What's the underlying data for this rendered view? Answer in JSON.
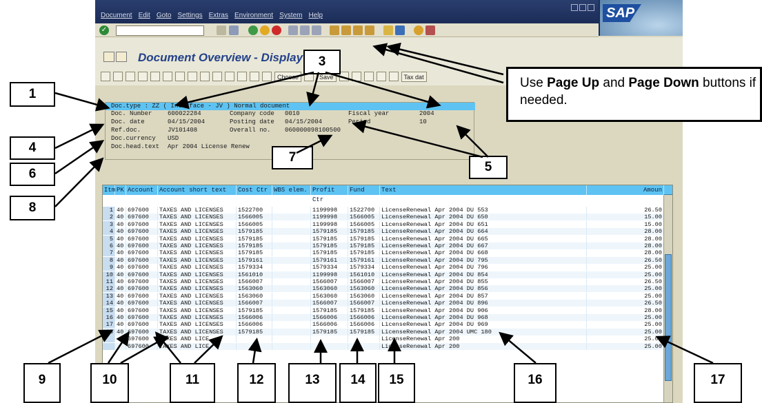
{
  "menu": [
    "Document",
    "Edit",
    "Goto",
    "Settings",
    "Extras",
    "Environment",
    "System",
    "Help"
  ],
  "app_logo": "SAP",
  "screen_title": "Document Overview - Display",
  "toolbar": {
    "choose_label": "Choose",
    "save_label": "Save",
    "tax_label": "Tax dat"
  },
  "header": {
    "line1": "Doc.type : ZZ ( Interface - JV ) Normal document",
    "doc_number_label": "Doc. Number",
    "doc_number": "600022284",
    "company_code_label": "Company code",
    "company_code": "0010",
    "fiscal_year_label": "Fiscal year",
    "fiscal_year": "2004",
    "doc_date_label": "Doc. date",
    "doc_date": "04/15/2004",
    "posting_date_label": "Posting date",
    "posting_date": "04/15/2004",
    "period_label": "Period",
    "period": "10",
    "ref_doc_label": "Ref.doc.",
    "ref_doc": "JV101408",
    "overall_no_label": "Overall no.",
    "overall_no": "060000098100500",
    "currency_label": "Doc.currency",
    "currency": "USD",
    "head_text_label": "Doc.head.text",
    "head_text": "Apr 2004 License Renew"
  },
  "table": {
    "columns": [
      "Itm",
      "PK",
      "Account",
      "Account short text",
      "Cost Ctr",
      "WBS elem.",
      "Profit Ctr",
      "Fund",
      "Text",
      "Amoun"
    ],
    "rows": [
      [
        "1",
        "40",
        "697600",
        "TAXES AND LICENSES",
        "1522700",
        "",
        "1199998",
        "1522700",
        "LicenseRenewal Apr 2004 DU 553",
        "26.50"
      ],
      [
        "2",
        "40",
        "697600",
        "TAXES AND LICENSES",
        "1566005",
        "",
        "1199998",
        "1566005",
        "LicenseRenewal Apr 2004 DU 650",
        "15.00"
      ],
      [
        "3",
        "40",
        "697600",
        "TAXES AND LICENSES",
        "1566005",
        "",
        "1199998",
        "1566005",
        "LicenseRenewal Apr 2004 DU 651",
        "15.00"
      ],
      [
        "4",
        "40",
        "697600",
        "TAXES AND LICENSES",
        "1579185",
        "",
        "1579185",
        "1579185",
        "LicenseRenewal Apr 2004 DU 664",
        "28.00"
      ],
      [
        "5",
        "40",
        "697600",
        "TAXES AND LICENSES",
        "1579185",
        "",
        "1579185",
        "1579185",
        "LicenseRenewal Apr 2004 DU 665",
        "28.00"
      ],
      [
        "6",
        "40",
        "697600",
        "TAXES AND LICENSES",
        "1579185",
        "",
        "1579185",
        "1579185",
        "LicenseRenewal Apr 2004 DU 667",
        "28.00"
      ],
      [
        "7",
        "40",
        "697600",
        "TAXES AND LICENSES",
        "1579185",
        "",
        "1579185",
        "1579185",
        "LicenseRenewal Apr 2004 DU 668",
        "28.00"
      ],
      [
        "8",
        "40",
        "697600",
        "TAXES AND LICENSES",
        "1579161",
        "",
        "1579161",
        "1579161",
        "LicenseRenewal Apr 2004 DU 795",
        "26.50"
      ],
      [
        "9",
        "40",
        "697600",
        "TAXES AND LICENSES",
        "1579334",
        "",
        "1579334",
        "1579334",
        "LicenseRenewal Apr 2004 DU 796",
        "25.00"
      ],
      [
        "10",
        "40",
        "697600",
        "TAXES AND LICENSES",
        "1561010",
        "",
        "1199998",
        "1561010",
        "LicenseRenewal Apr 2004 DU 854",
        "25.00"
      ],
      [
        "11",
        "40",
        "697600",
        "TAXES AND LICENSES",
        "1566007",
        "",
        "1566007",
        "1566007",
        "LicenseRenewal Apr 2004 DU 855",
        "26.50"
      ],
      [
        "12",
        "40",
        "697600",
        "TAXES AND LICENSES",
        "1563060",
        "",
        "1563060",
        "1563060",
        "LicenseRenewal Apr 2004 DU 856",
        "25.00"
      ],
      [
        "13",
        "40",
        "697600",
        "TAXES AND LICENSES",
        "1563060",
        "",
        "1563060",
        "1563060",
        "LicenseRenewal Apr 2004 DU 857",
        "25.00"
      ],
      [
        "14",
        "40",
        "697600",
        "TAXES AND LICENSES",
        "1566007",
        "",
        "1566007",
        "1566007",
        "LicenseRenewal Apr 2004 DU 896",
        "26.50"
      ],
      [
        "15",
        "40",
        "697600",
        "TAXES AND LICENSES",
        "1579185",
        "",
        "1579185",
        "1579185",
        "LicenseRenewal Apr 2004 DU 906",
        "28.00"
      ],
      [
        "16",
        "40",
        "697600",
        "TAXES AND LICENSES",
        "1566006",
        "",
        "1566006",
        "1566006",
        "LicenseRenewal Apr 2004 DU 968",
        "25.00"
      ],
      [
        "17",
        "40",
        "697600",
        "TAXES AND LICENSES",
        "1566006",
        "",
        "1566006",
        "1566006",
        "LicenseRenewal Apr 2004 DU 969",
        "25.00"
      ],
      [
        "18",
        "40",
        "697600",
        "TAXES AND LICENSES",
        "1579185",
        "",
        "1579185",
        "1579185",
        "LicenseRenewal Apr 2004 UMC 180",
        "25.00"
      ],
      [
        "",
        "",
        "697600",
        "TAXES AND LICE",
        "",
        "",
        "",
        "",
        "LicenseRenewal Apr 200",
        "25.00"
      ],
      [
        "",
        "",
        "697600",
        "TAXES AND LICE",
        "",
        "",
        "",
        "",
        "LicenseRenewal Apr 200",
        "25.00"
      ]
    ]
  },
  "callout": {
    "prefix": "Use ",
    "b1": "Page Up",
    "mid": " and ",
    "b2": "Page Down",
    "suffix": " buttons if needed."
  },
  "labels": [
    "1",
    "3",
    "4",
    "5",
    "6",
    "7",
    "8",
    "9",
    "10",
    "11",
    "12",
    "13",
    "14",
    "15",
    "16",
    "17"
  ]
}
